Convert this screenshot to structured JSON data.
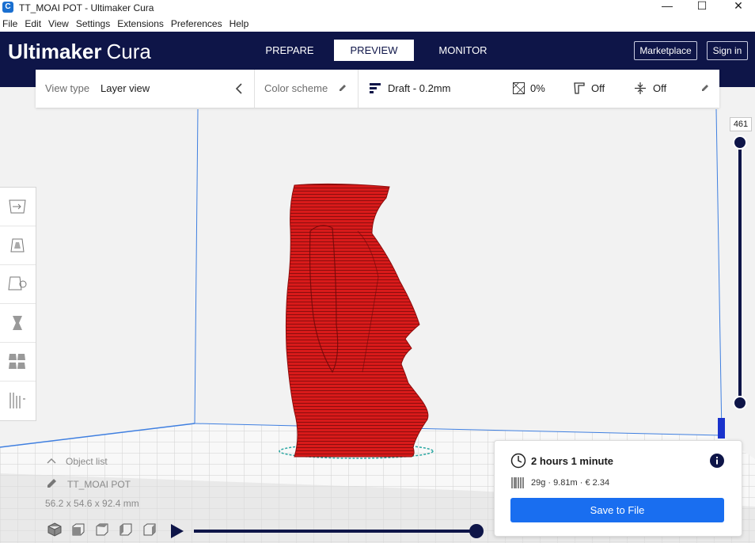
{
  "window": {
    "title": "TT_MOAI POT - Ultimaker Cura",
    "app_icon": "C",
    "minimize_glyph": "—",
    "maximize_glyph": "☐",
    "close_glyph": "✕"
  },
  "menu": [
    "File",
    "Edit",
    "View",
    "Settings",
    "Extensions",
    "Preferences",
    "Help"
  ],
  "header": {
    "logo_bold": "Ultimaker",
    "logo_light": "Cura",
    "tabs": [
      {
        "label": "PREPARE",
        "active": false
      },
      {
        "label": "PREVIEW",
        "active": true
      },
      {
        "label": "MONITOR",
        "active": false
      }
    ],
    "marketplace_label": "Marketplace",
    "signin_label": "Sign in",
    "brand_color": "#0e1548"
  },
  "viewbar": {
    "view_type_label": "View type",
    "view_type_value": "Layer view",
    "color_scheme_label": "Color scheme",
    "profile": "Draft - 0.2mm",
    "infill": "0%",
    "support": "Off",
    "adhesion": "Off"
  },
  "tools": [
    "move-tool-icon",
    "scale-tool-icon",
    "rotate-tool-icon",
    "mirror-tool-icon",
    "per-model-settings-icon",
    "support-blocker-icon"
  ],
  "layer_slider": {
    "value": "461"
  },
  "object_list": {
    "toggle_label": "Object list",
    "object_name": "TT_MOAI POT",
    "dimensions": "56.2 x 54.6 x 92.4 mm"
  },
  "camera_views": [
    "3d-view-icon",
    "front-view-icon",
    "top-view-icon",
    "left-view-icon",
    "right-view-icon"
  ],
  "print_info": {
    "time": "2 hours 1 minute",
    "material": "29g · 9.81m · € 2.34",
    "save_label": "Save to File",
    "accent_color": "#196ef0"
  },
  "model_color": "#d01414"
}
